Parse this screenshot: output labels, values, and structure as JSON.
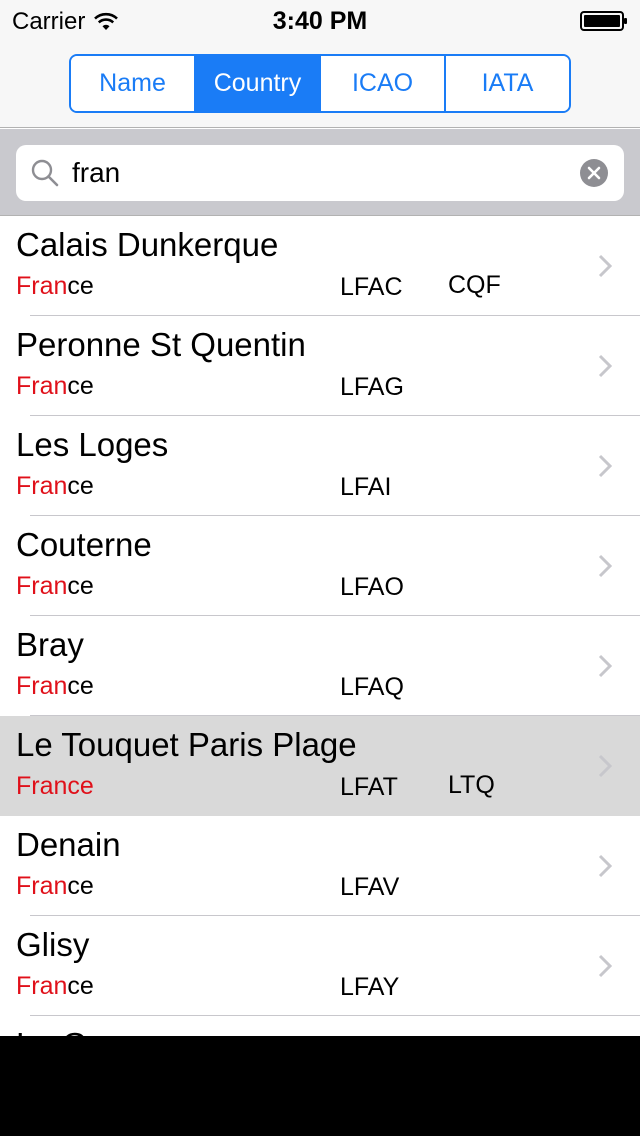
{
  "status_bar": {
    "carrier": "Carrier",
    "time": "3:40 PM"
  },
  "segments": [
    {
      "label": "Name",
      "selected": false
    },
    {
      "label": "Country",
      "selected": true
    },
    {
      "label": "ICAO",
      "selected": false
    },
    {
      "label": "IATA",
      "selected": false
    }
  ],
  "search": {
    "value": "fran"
  },
  "rows": [
    {
      "name": "Calais Dunkerque",
      "country_match": "Fran",
      "country_rest": "ce",
      "icao": "LFAC",
      "iata": "CQF",
      "highlighted": false
    },
    {
      "name": "Peronne St Quentin",
      "country_match": "Fran",
      "country_rest": "ce",
      "icao": "LFAG",
      "iata": "",
      "highlighted": false
    },
    {
      "name": "Les Loges",
      "country_match": "Fran",
      "country_rest": "ce",
      "icao": "LFAI",
      "iata": "",
      "highlighted": false
    },
    {
      "name": "Couterne",
      "country_match": "Fran",
      "country_rest": "ce",
      "icao": "LFAO",
      "iata": "",
      "highlighted": false
    },
    {
      "name": "Bray",
      "country_match": "Fran",
      "country_rest": "ce",
      "icao": "LFAQ",
      "iata": "",
      "highlighted": false
    },
    {
      "name": "Le Touquet Paris Plage",
      "country_match": "France",
      "country_rest": "",
      "icao": "LFAT",
      "iata": "LTQ",
      "highlighted": true
    },
    {
      "name": "Denain",
      "country_match": "Fran",
      "country_rest": "ce",
      "icao": "LFAV",
      "iata": "",
      "highlighted": false
    },
    {
      "name": "Glisy",
      "country_match": "Fran",
      "country_rest": "ce",
      "icao": "LFAY",
      "iata": "",
      "highlighted": false
    },
    {
      "name": "Le G",
      "country_match": "",
      "country_rest": "",
      "icao": "",
      "iata": "",
      "highlighted": false
    }
  ],
  "colors": {
    "accent": "#1a7cf6",
    "match": "#e0101a",
    "highlight": "#d9d9d9"
  }
}
